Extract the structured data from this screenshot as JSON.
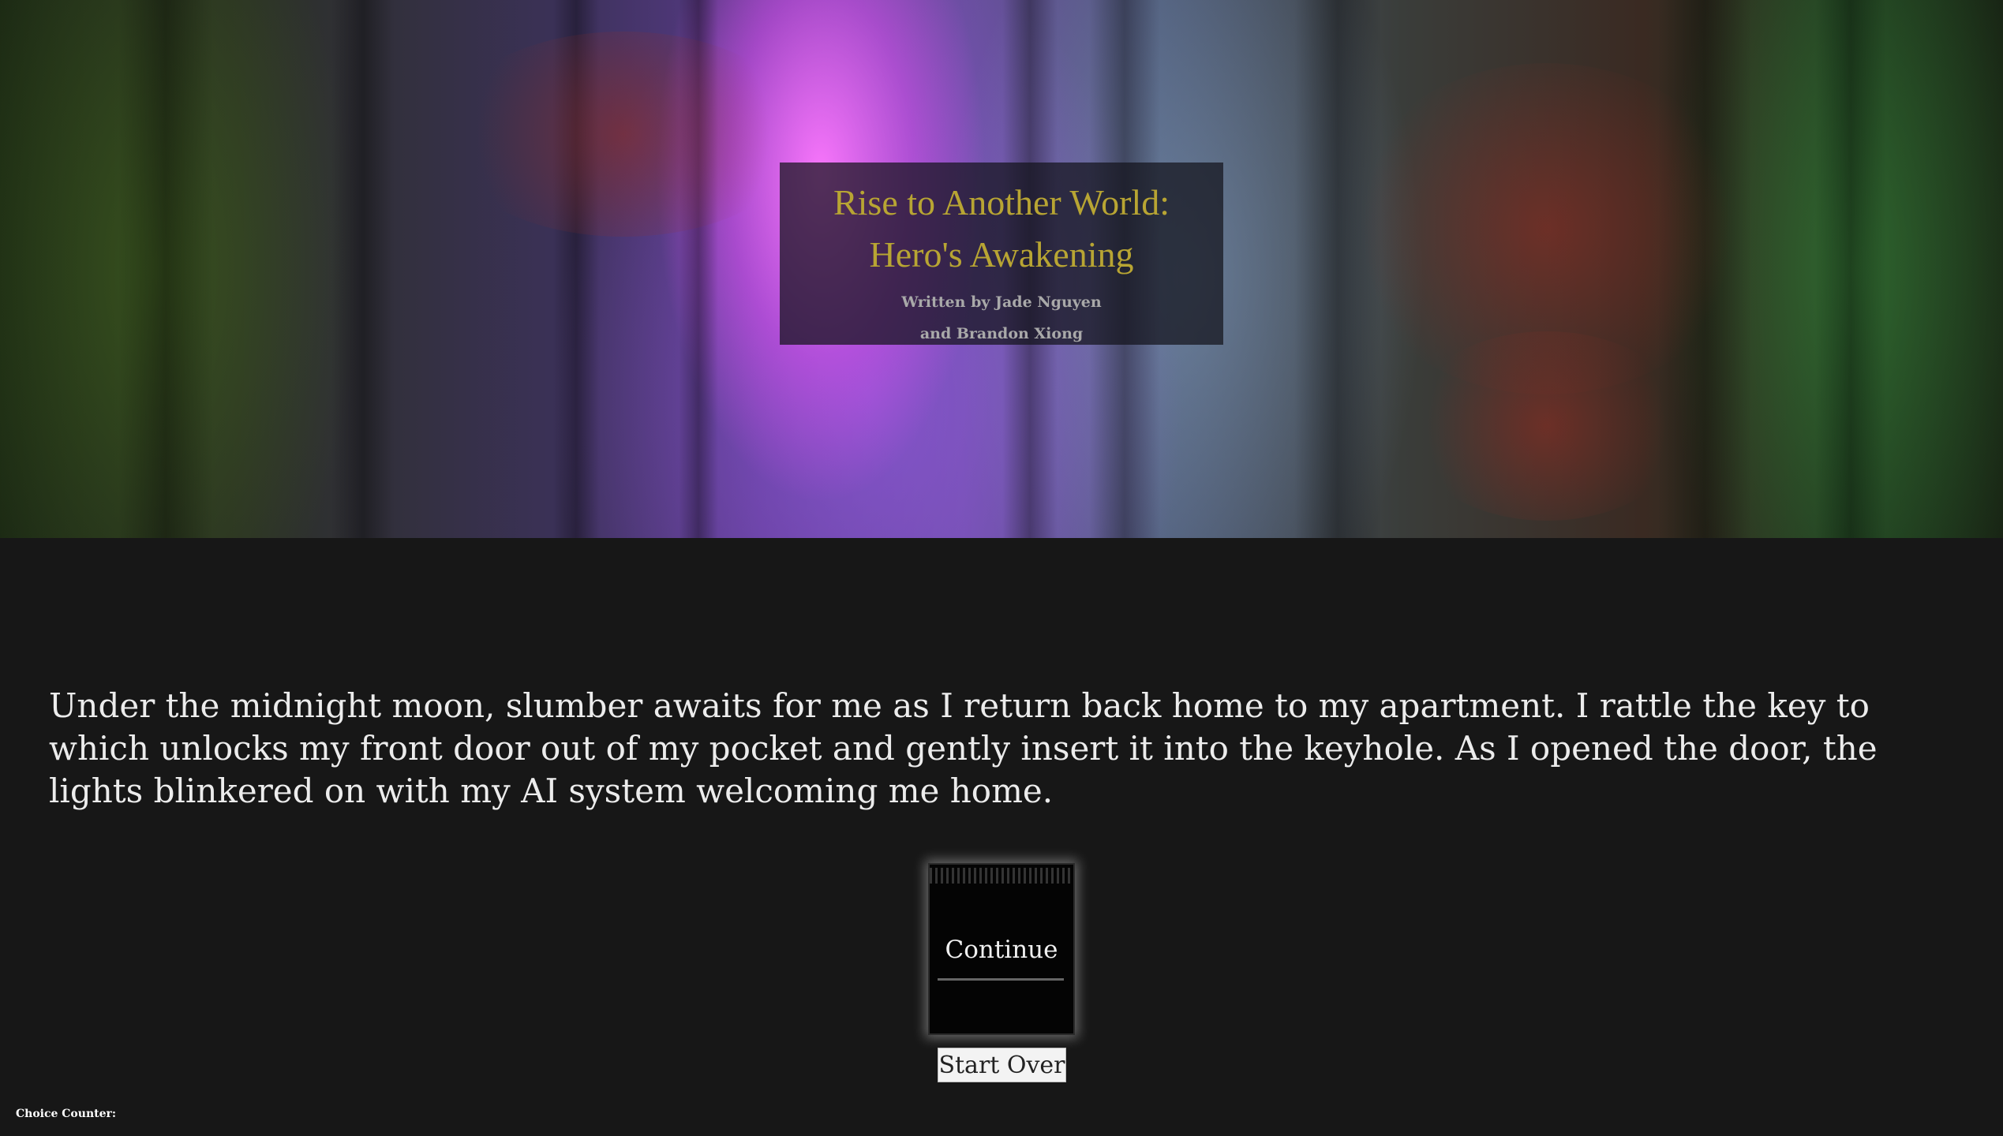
{
  "header": {
    "title_line1": "Rise to Another World:",
    "title_line2": "Hero's Awakening",
    "byline_line1": "Written by Jade Nguyen",
    "byline_line2": "and Brandon Xiong"
  },
  "story": {
    "text": "Under the midnight moon, slumber awaits for me as I return back home to my apartment. I rattle the key to which unlocks my front door out of my pocket and gently insert it into the keyhole. As I opened the door, the lights blinkered on with my AI system welcoming me home."
  },
  "choices": {
    "continue_label": "Continue",
    "start_over_label": "Start Over"
  },
  "footer": {
    "choice_counter_label": "Choice Counter:"
  }
}
